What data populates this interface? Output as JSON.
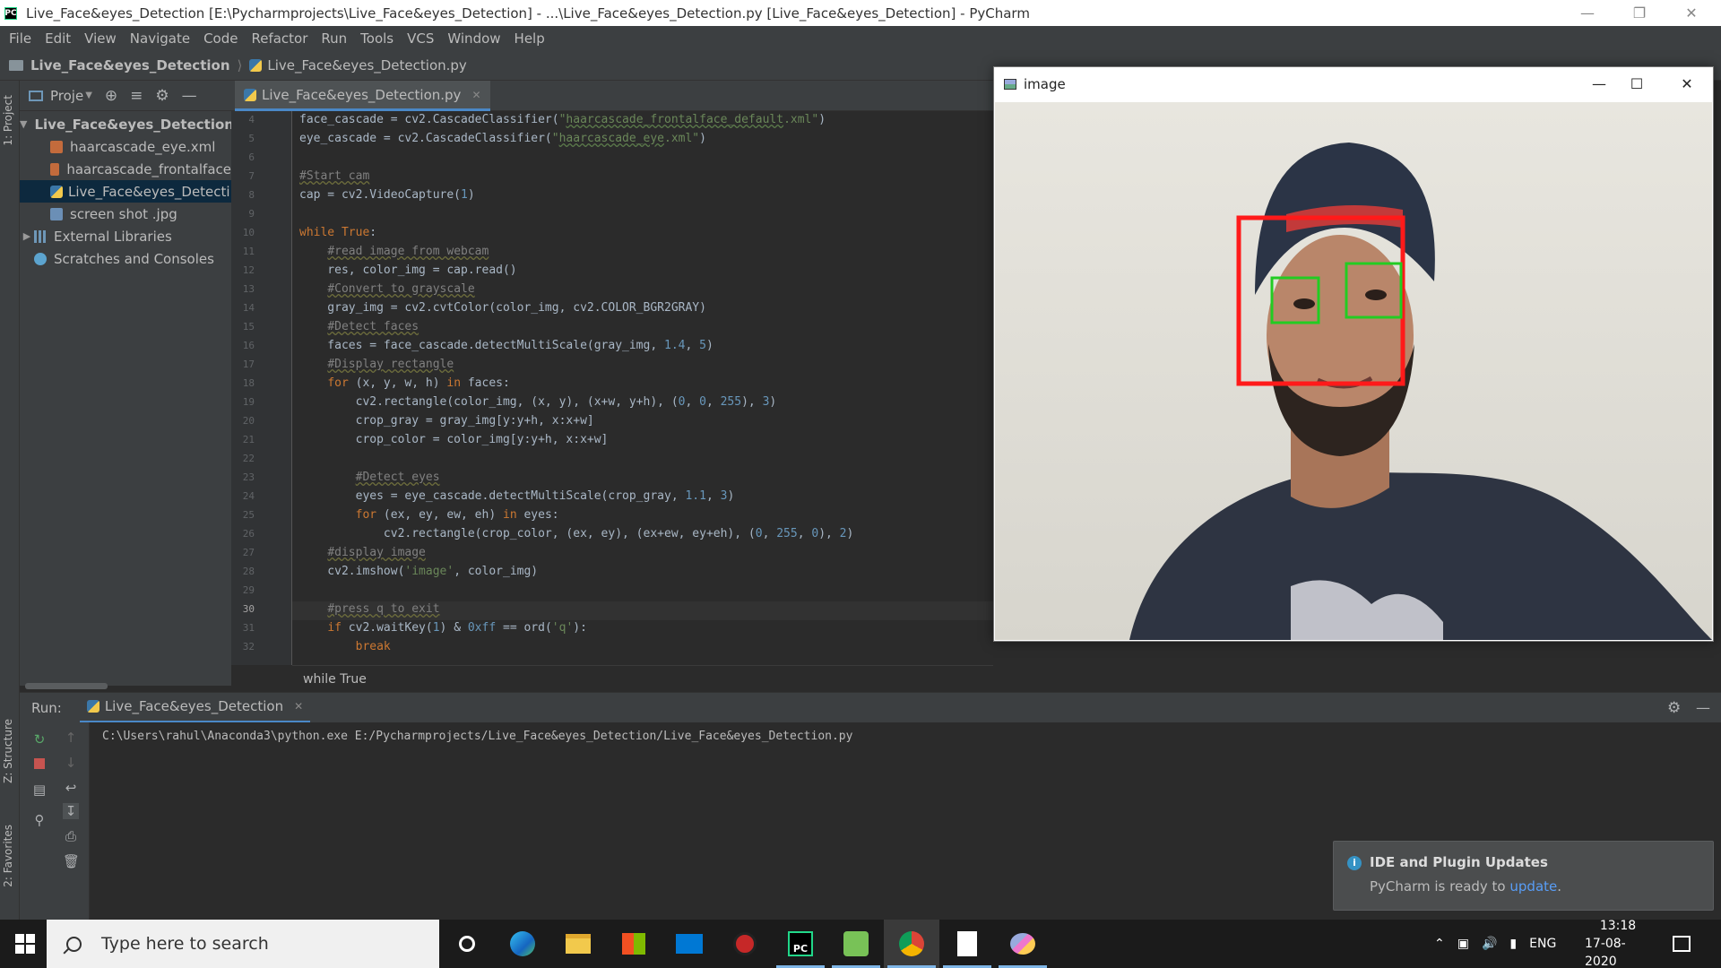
{
  "window": {
    "title": "Live_Face&eyes_Detection [E:\\Pycharmprojects\\Live_Face&eyes_Detection] - ...\\Live_Face&eyes_Detection.py [Live_Face&eyes_Detection] - PyCharm",
    "app_icon": "PC"
  },
  "menu": [
    "File",
    "Edit",
    "View",
    "Navigate",
    "Code",
    "Refactor",
    "Run",
    "Tools",
    "VCS",
    "Window",
    "Help"
  ],
  "breadcrumb": {
    "project": "Live_Face&eyes_Detection",
    "file": "Live_Face&eyes_Detection.py"
  },
  "side_tabs": {
    "project": "1: Project",
    "structure": "Z: Structure",
    "favorites": "2: Favorites"
  },
  "project_panel": {
    "label": "Proje",
    "tree": [
      {
        "label": "Live_Face&eyes_Detection",
        "icon": "folder",
        "expanded": true
      },
      {
        "label": "haarcascade_eye.xml",
        "icon": "xml"
      },
      {
        "label": "haarcascade_frontalface",
        "icon": "xml"
      },
      {
        "label": "Live_Face&eyes_Detecti",
        "icon": "python",
        "selected": true
      },
      {
        "label": "screen shot .jpg",
        "icon": "image"
      },
      {
        "label": "External Libraries",
        "icon": "library"
      },
      {
        "label": "Scratches and Consoles",
        "icon": "scratches"
      }
    ]
  },
  "editor": {
    "tab": "Live_Face&eyes_Detection.py",
    "line_numbers": [
      "4",
      "5",
      "6",
      "7",
      "8",
      "9",
      "10",
      "11",
      "12",
      "13",
      "14",
      "15",
      "16",
      "17",
      "18",
      "19",
      "20",
      "21",
      "22",
      "23",
      "24",
      "25",
      "26",
      "27",
      "28",
      "29",
      "30",
      "31",
      "32"
    ],
    "current_line": "30",
    "footer_breadcrumb": "while True"
  },
  "image_window": {
    "title": "image"
  },
  "run_panel": {
    "label": "Run:",
    "tab": "Live_Face&eyes_Detection",
    "output": "C:\\Users\\rahul\\Anaconda3\\python.exe E:/Pycharmprojects/Live_Face&eyes_Detection/Live_Face&eyes_Detection.py"
  },
  "notification": {
    "title": "IDE and Plugin Updates",
    "body_prefix": "PyCharm is ready to ",
    "link": "update",
    "body_suffix": "."
  },
  "taskbar": {
    "search_placeholder": "Type here to search",
    "apps": [
      "cortana",
      "edge",
      "file-explorer",
      "store",
      "mail",
      "antivirus",
      "pycharm",
      "android-studio",
      "chrome",
      "notepad",
      "paint"
    ],
    "language": "ENG",
    "time": "13:18",
    "date": "17-08-2020"
  }
}
